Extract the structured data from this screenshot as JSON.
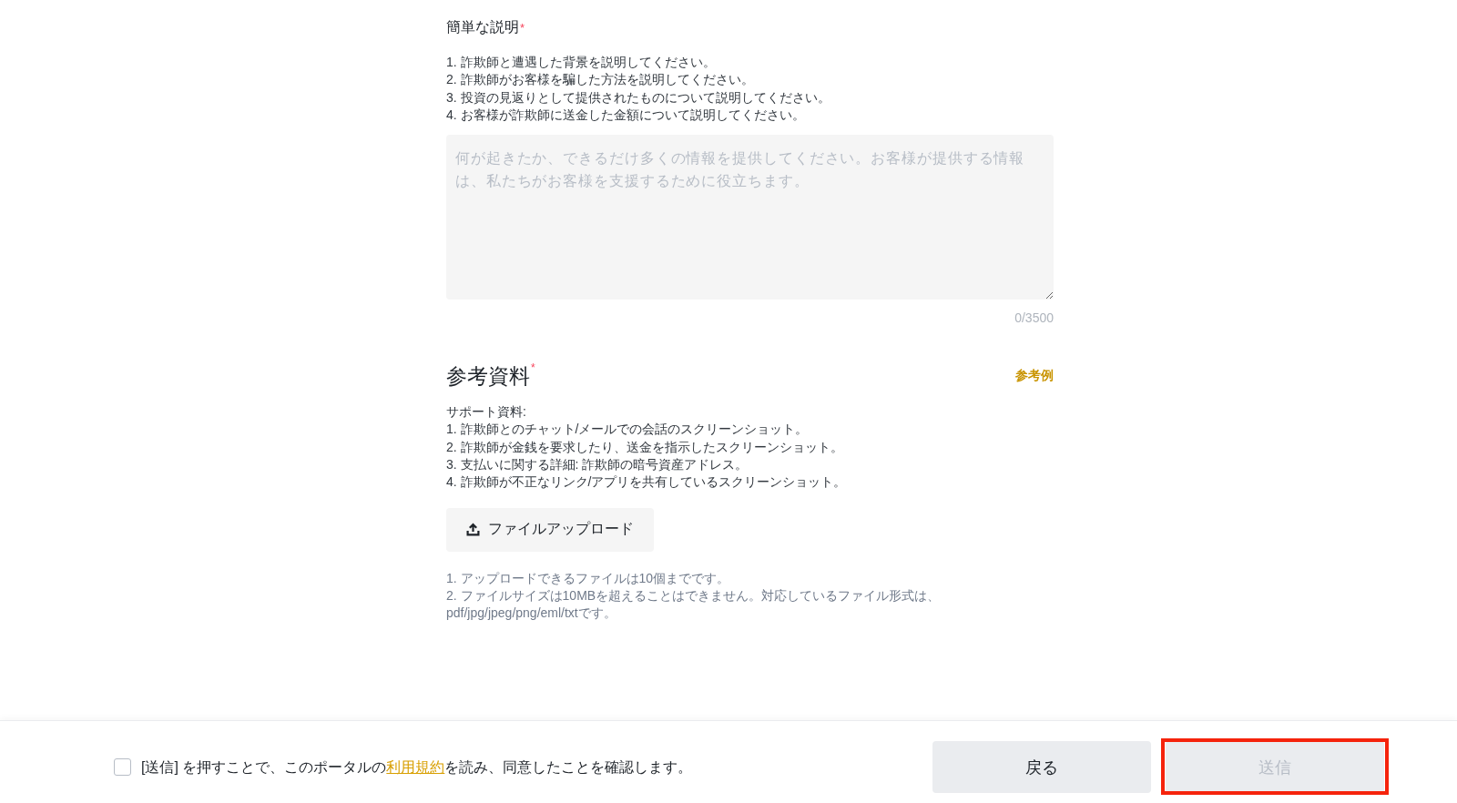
{
  "description_section": {
    "title": "簡単な説明",
    "required_mark": "*",
    "instructions": [
      "1. 詐欺師と遭遇した背景を説明してください。",
      "2. 詐欺師がお客様を騙した方法を説明してください。",
      "3. 投資の見返りとして提供されたものについて説明してください。",
      "4. お客様が詐欺師に送金した金額について説明してください。"
    ],
    "textarea": {
      "placeholder": "何が起きたか、できるだけ多くの情報を提供してください。お客様が提供する情報は、私たちがお客様を支援するために役立ちます。"
    },
    "char_counter": "0/3500"
  },
  "evidence_section": {
    "title": "参考資料",
    "required_mark": "*",
    "example_link": "参考例",
    "instructions": [
      "サポート資料:",
      "1. 詐欺師とのチャット/メールでの会話のスクリーンショット。",
      "2. 詐欺師が金銭を要求したり、送金を指示したスクリーンショット。",
      "3. 支払いに関する詳細: 詐欺師の暗号資産アドレス。",
      "4. 詐欺師が不正なリンク/アプリを共有しているスクリーンショット。"
    ],
    "upload_button": {
      "label": "ファイルアップロード"
    },
    "notes": [
      "1. アップロードできるファイルは10個までです。",
      "2. ファイルサイズは10MBを超えることはできません。対応しているファイル形式は、pdf/jpg/jpeg/png/eml/txtです。"
    ]
  },
  "footer": {
    "agreement": {
      "checked": false,
      "text_before": "[送信] を押すことで、このポータルの",
      "link": "利用規約",
      "text_after": "を読み、同意したことを確認します。"
    },
    "buttons": [
      {
        "label": "戻る",
        "kind": "secondary",
        "disabled": false,
        "highlighted": false
      },
      {
        "label": "送信",
        "kind": "primary",
        "disabled": true,
        "highlighted": true
      }
    ]
  }
}
